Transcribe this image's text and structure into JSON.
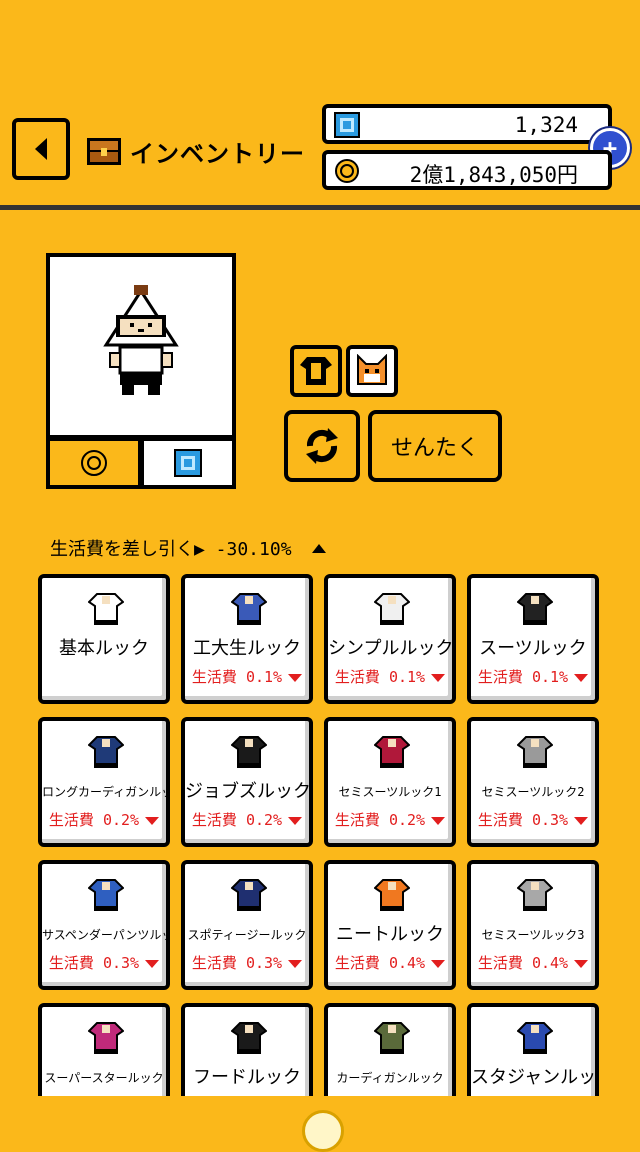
{
  "header": {
    "title": "インベントリー",
    "gems": "1,324",
    "money": "2億1,843,050円"
  },
  "preview": {
    "tab_coin_icon": "coin-icon",
    "tab_gem_icon": "gem-icon"
  },
  "controls": {
    "select_label": "せんたく"
  },
  "deduction": "生活費を差し引く▶ -30.10%",
  "items": [
    {
      "name": "基本ルック",
      "stat": "",
      "color": "#ffffff",
      "small": false
    },
    {
      "name": "工大生ルック",
      "stat": "生活費 0.1%",
      "color": "#3a5ab8",
      "small": false
    },
    {
      "name": "シンプルルック",
      "stat": "生活費 0.1%",
      "color": "#f0f0f0",
      "small": false
    },
    {
      "name": "スーツルック",
      "stat": "生活費 0.1%",
      "color": "#222222",
      "small": false
    },
    {
      "name": "ロングカーディガンルック",
      "stat": "生活費 0.2%",
      "color": "#1f3a78",
      "small": true
    },
    {
      "name": "ジョブズルック",
      "stat": "生活費 0.2%",
      "color": "#1a1a1a",
      "small": false
    },
    {
      "name": "セミスーツルック1",
      "stat": "生活費 0.2%",
      "color": "#b0183a",
      "small": true
    },
    {
      "name": "セミスーツルック2",
      "stat": "生活費 0.3%",
      "color": "#9a9a9a",
      "small": true
    },
    {
      "name": "サスペンダーパンツルック",
      "stat": "生活費 0.3%",
      "color": "#2f5fc0",
      "small": true
    },
    {
      "name": "スポティージールック",
      "stat": "生活費 0.3%",
      "color": "#1f2f70",
      "small": true
    },
    {
      "name": "ニートルック",
      "stat": "生活費 0.4%",
      "color": "#f07820",
      "small": false
    },
    {
      "name": "セミスーツルック3",
      "stat": "生活費 0.4%",
      "color": "#a8a8a8",
      "small": true
    },
    {
      "name": "スーパースタールック",
      "stat": "",
      "color": "#c02a7a",
      "small": true
    },
    {
      "name": "フードルック",
      "stat": "",
      "color": "#1a1a1a",
      "small": false
    },
    {
      "name": "カーディガンルック",
      "stat": "",
      "color": "#5a6a3a",
      "small": true
    },
    {
      "name": "スタジャンルック",
      "stat": "",
      "color": "#2a4ab0",
      "small": false
    }
  ]
}
